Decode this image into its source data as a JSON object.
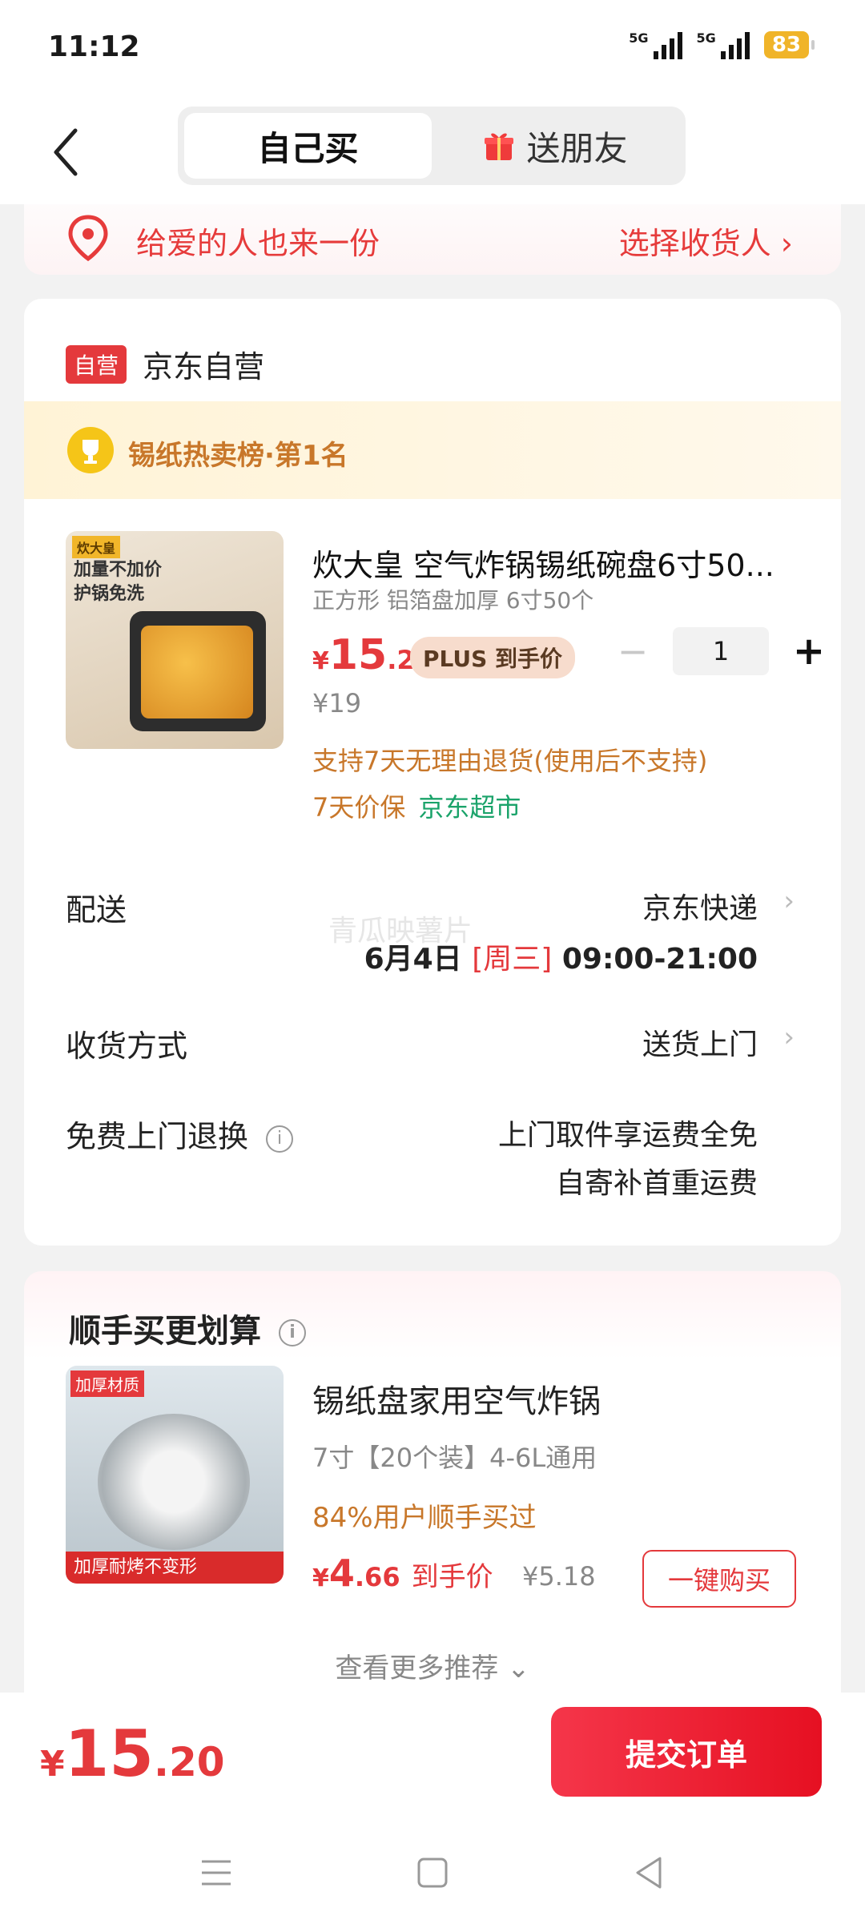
{
  "status": {
    "time": "11:12",
    "signal1": "5G",
    "signal2": "5G",
    "battery": "83"
  },
  "header": {
    "tab_self": "自己买",
    "tab_gift": "送朋友"
  },
  "gift_banner": {
    "text": "给爱的人也来一份",
    "action": "选择收货人 ›"
  },
  "store": {
    "badge": "自营",
    "name": "京东自营",
    "rank": "锡纸热卖榜·第1名"
  },
  "product": {
    "image_tags": [
      "炊大皇",
      "加量不加价",
      "护锅免洗"
    ],
    "title": "炊大皇 空气炸锅锡纸碗盘6寸50...",
    "spec": "正方形 铝箔盘加厚 6寸50个",
    "price_currency": "¥",
    "price_int": "15",
    "price_dec": ".2",
    "plus_label": "PLUS 到手价",
    "quantity": "1",
    "minus": "−",
    "plus": "+",
    "original_price": "¥19",
    "return_policy": "支持7天无理由退货(使用后不支持)",
    "price_protect": "7天价保",
    "market": "京东超市"
  },
  "delivery": {
    "label": "配送",
    "value": "京东快递",
    "date": "6月4日",
    "weekday": "[周三]",
    "time": "09:00-21:00",
    "watermark": "青瓜映薯片"
  },
  "receive": {
    "label": "收货方式",
    "value": "送货上门"
  },
  "returns": {
    "label": "免费上门退换",
    "info": "i",
    "line1": "上门取件享运费全免",
    "line2": "自寄补首重运费"
  },
  "recommend": {
    "title": "顺手买更划算",
    "info": "i",
    "image_tags": [
      "加厚材质",
      "加厚耐烤不变形"
    ],
    "name": "锡纸盘家用空气炸锅",
    "spec": "7寸【20个装】4-6L通用",
    "bought": "84%用户顺手买过",
    "price_currency": "¥",
    "price_int": "4",
    "price_dec": ".66",
    "price_label": "到手价",
    "original_price": "¥5.18",
    "buy_button": "一键购买",
    "more": "查看更多推荐 ⌄"
  },
  "footer": {
    "currency": "¥",
    "total_int": "15",
    "total_dec": ".20",
    "submit": "提交订单"
  },
  "colors": {
    "accent": "#e4393c",
    "gold": "#c8772a",
    "green": "#1aa36a"
  }
}
